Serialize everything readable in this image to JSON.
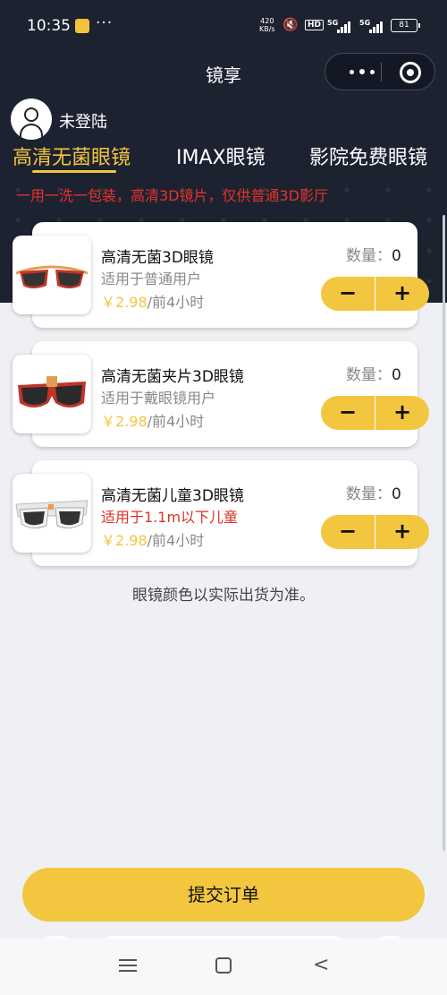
{
  "status_bar": {
    "time": "10:35",
    "more": "···",
    "speed_value": "420",
    "speed_unit": "KB/s",
    "hd_label": "HD",
    "sim1_label": "5G",
    "sim2_label": "5G",
    "battery": "81"
  },
  "nav": {
    "title": "镜享"
  },
  "user": {
    "login_status": "未登陆"
  },
  "tabs": [
    {
      "label": "高清无菌眼镜",
      "active": true
    },
    {
      "label": "IMAX眼镜",
      "active": false
    },
    {
      "label": "影院免费眼镜",
      "active": false
    }
  ],
  "notice": "一用一洗一包装，高清3D镜片，仅供普通3D影厅",
  "products": [
    {
      "name": "高清无菌3D眼镜",
      "desc": "适用于普通用户",
      "currency": "￥",
      "price": "2.98",
      "price_unit": "/前4小时",
      "qty_label": "数量：",
      "qty": "0",
      "minus": "−",
      "plus": "+",
      "image_icon": "red-frame-sunglasses-icon"
    },
    {
      "name": "高清无菌夹片3D眼镜",
      "desc": "适用于戴眼镜用户",
      "currency": "￥",
      "price": "2.98",
      "price_unit": "/前4小时",
      "qty_label": "数量：",
      "qty": "0",
      "minus": "−",
      "plus": "+",
      "image_icon": "clip-on-glasses-icon"
    },
    {
      "name": "高清无菌儿童3D眼镜",
      "desc": "适用于1.1m以下儿童",
      "currency": "￥",
      "price": "2.98",
      "price_unit": "/前4小时",
      "qty_label": "数量：",
      "qty": "0",
      "minus": "−",
      "plus": "+",
      "image_icon": "kids-white-glasses-icon"
    }
  ],
  "footnote": "眼镜颜色以实际出货为准。",
  "submit_label": "提交订单",
  "system_nav": {
    "back_glyph": "<"
  },
  "colors": {
    "accent": "#f3c640",
    "header_bg": "#1d2231",
    "notice_red": "#e8332a",
    "page_bg": "#eef0f3"
  }
}
